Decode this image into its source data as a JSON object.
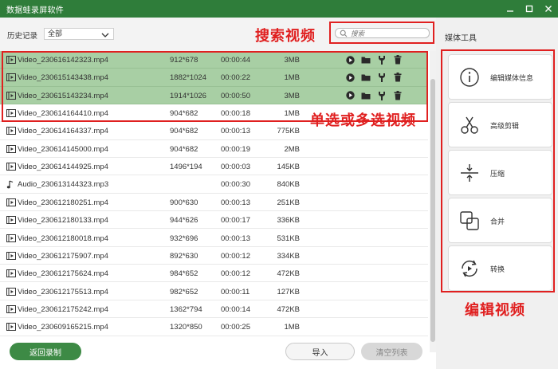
{
  "window": {
    "title": "数据蛙录屏软件"
  },
  "toolbar": {
    "history_label": "历史记录",
    "history_filter": "全部",
    "search_placeholder": "搜索"
  },
  "annotations": {
    "search": "搜索视频",
    "multi_select": "单选或多选视频",
    "edit": "编辑视频"
  },
  "files": [
    {
      "name": "Video_230616142323.mp4",
      "resolution": "912*678",
      "duration": "00:00:44",
      "size": "3MB",
      "selected": true,
      "type": "video"
    },
    {
      "name": "Video_230615143438.mp4",
      "resolution": "1882*1024",
      "duration": "00:00:22",
      "size": "1MB",
      "selected": true,
      "type": "video"
    },
    {
      "name": "Video_230615143234.mp4",
      "resolution": "1914*1026",
      "duration": "00:00:50",
      "size": "3MB",
      "selected": true,
      "type": "video"
    },
    {
      "name": "Video_230614164410.mp4",
      "resolution": "904*682",
      "duration": "00:00:18",
      "size": "1MB",
      "selected": false,
      "type": "video"
    },
    {
      "name": "Video_230614164337.mp4",
      "resolution": "904*682",
      "duration": "00:00:13",
      "size": "775KB",
      "selected": false,
      "type": "video"
    },
    {
      "name": "Video_230614145000.mp4",
      "resolution": "904*682",
      "duration": "00:00:19",
      "size": "2MB",
      "selected": false,
      "type": "video"
    },
    {
      "name": "Video_230614144925.mp4",
      "resolution": "1496*194",
      "duration": "00:00:03",
      "size": "145KB",
      "selected": false,
      "type": "video"
    },
    {
      "name": "Audio_230613144323.mp3",
      "resolution": "",
      "duration": "00:00:30",
      "size": "840KB",
      "selected": false,
      "type": "audio"
    },
    {
      "name": "Video_230612180251.mp4",
      "resolution": "900*630",
      "duration": "00:00:13",
      "size": "251KB",
      "selected": false,
      "type": "video"
    },
    {
      "name": "Video_230612180133.mp4",
      "resolution": "944*626",
      "duration": "00:00:17",
      "size": "336KB",
      "selected": false,
      "type": "video"
    },
    {
      "name": "Video_230612180018.mp4",
      "resolution": "932*696",
      "duration": "00:00:13",
      "size": "531KB",
      "selected": false,
      "type": "video"
    },
    {
      "name": "Video_230612175907.mp4",
      "resolution": "892*630",
      "duration": "00:00:12",
      "size": "334KB",
      "selected": false,
      "type": "video"
    },
    {
      "name": "Video_230612175624.mp4",
      "resolution": "984*652",
      "duration": "00:00:12",
      "size": "472KB",
      "selected": false,
      "type": "video"
    },
    {
      "name": "Video_230612175513.mp4",
      "resolution": "982*652",
      "duration": "00:00:11",
      "size": "127KB",
      "selected": false,
      "type": "video"
    },
    {
      "name": "Video_230612175242.mp4",
      "resolution": "1362*794",
      "duration": "00:00:14",
      "size": "472KB",
      "selected": false,
      "type": "video"
    },
    {
      "name": "Video_230609165215.mp4",
      "resolution": "1320*850",
      "duration": "00:00:25",
      "size": "1MB",
      "selected": false,
      "type": "video"
    }
  ],
  "row_actions": [
    "play-icon",
    "folder-icon",
    "edit-tool-icon",
    "trash-icon"
  ],
  "bottom": {
    "back_label": "返回录制",
    "import_label": "导入",
    "clear_label": "清空列表"
  },
  "media_tools": {
    "title": "媒体工具",
    "items": [
      {
        "label": "编辑媒体信息",
        "icon": "info-icon"
      },
      {
        "label": "高级剪辑",
        "icon": "scissors-icon"
      },
      {
        "label": "压缩",
        "icon": "compress-icon"
      },
      {
        "label": "合并",
        "icon": "merge-icon"
      },
      {
        "label": "转换",
        "icon": "convert-icon"
      }
    ]
  },
  "colors": {
    "titlebar": "#2f7d3a",
    "selected_row": "#a8cfa4",
    "annotation": "#e02020",
    "primary_button": "#3d8a45"
  }
}
